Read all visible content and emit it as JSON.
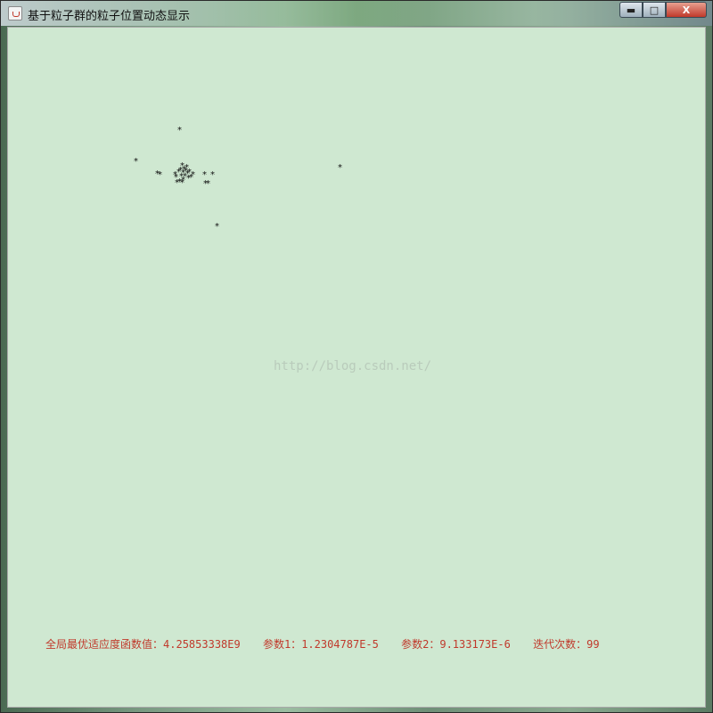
{
  "window": {
    "title": "基于粒子群的粒子位置动态显示",
    "controls": {
      "minimize": "▬",
      "maximize": "□",
      "close": "X"
    }
  },
  "canvas": {
    "background": "#cfe8d1",
    "particle_symbol": "*",
    "particle_count": 30,
    "watermark": "http://blog.csdn.net/"
  },
  "status": {
    "best_fitness_label": "全局最优适应度函数值：",
    "best_fitness_value": "4.25853338E9",
    "param1_label": "参数1：",
    "param1_value": "1.2304787E-5",
    "param2_label": "参数2：",
    "param2_value": "9.133173E-6",
    "iterations_label": "迭代次数：",
    "iterations_value": "99",
    "color": "#c0392b"
  }
}
